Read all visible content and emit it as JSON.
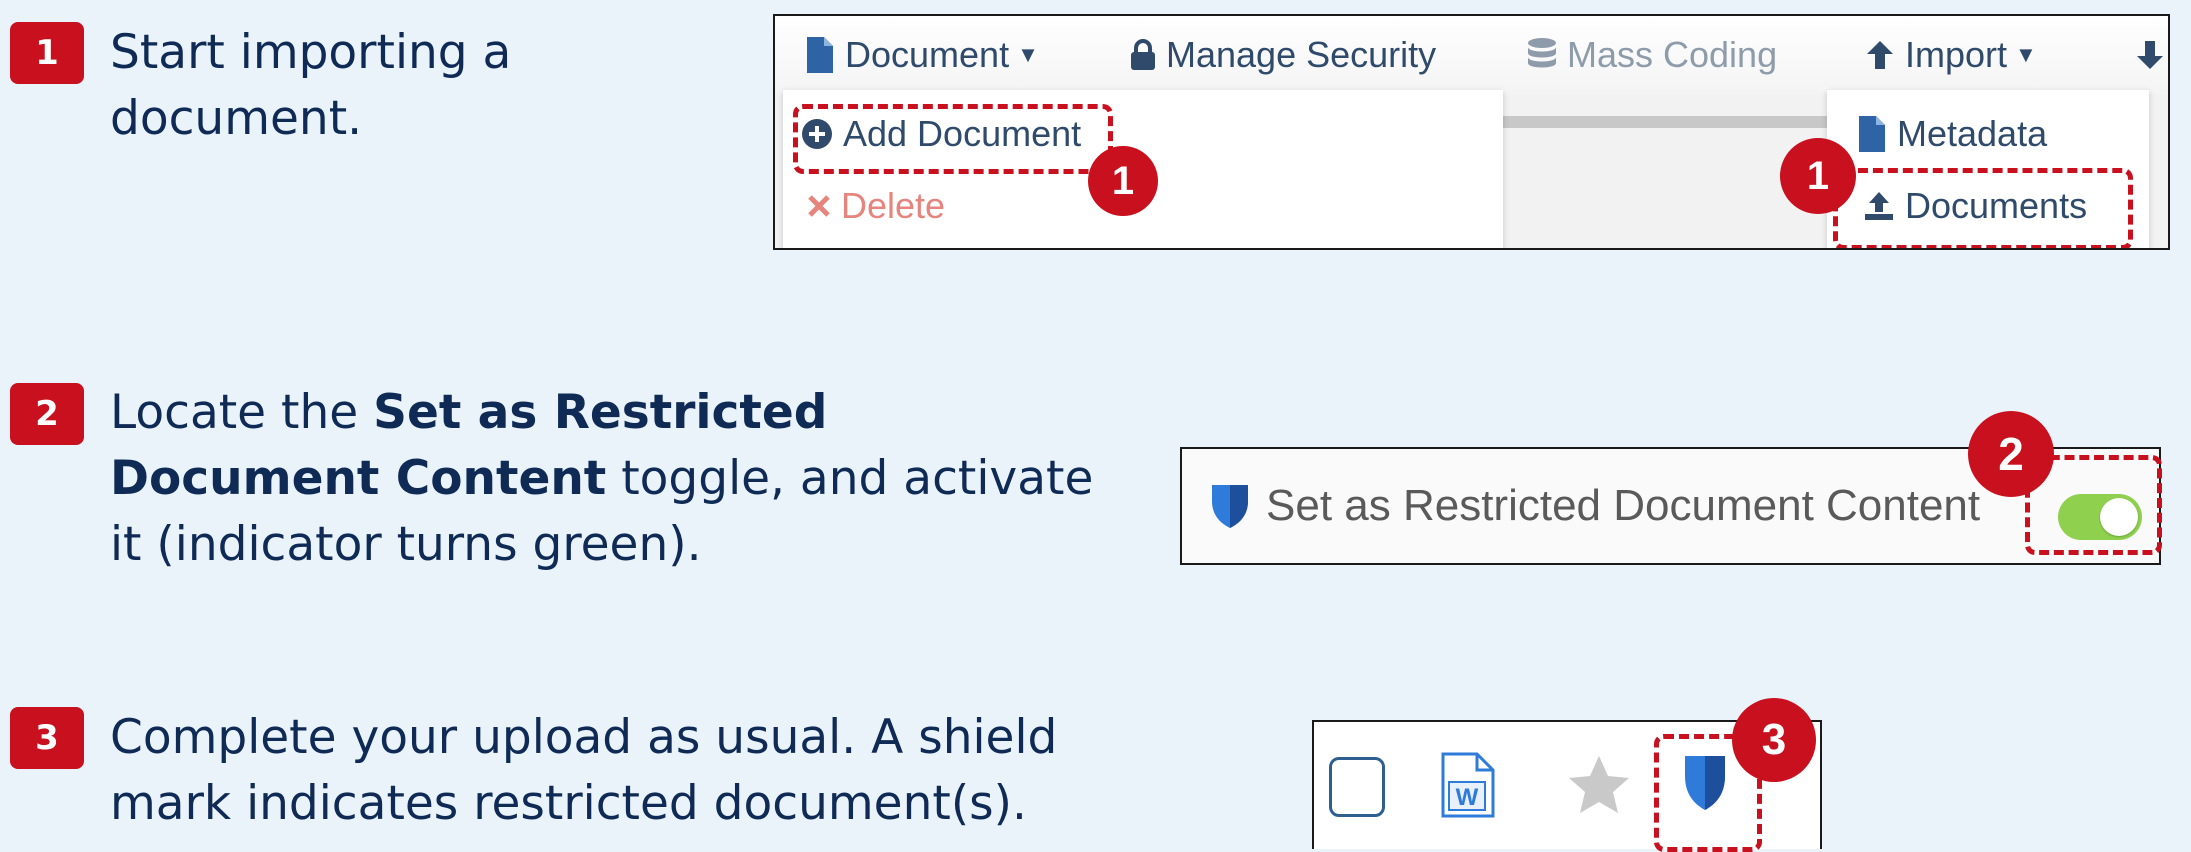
{
  "steps": [
    {
      "number": "1",
      "text": "Start importing a document."
    },
    {
      "number": "2",
      "text_before": "Locate the ",
      "bold": "Set as Restricted Document Content",
      "text_after": " toggle, and activate it (indicator turns green)."
    },
    {
      "number": "3",
      "text": "Complete your upload as usual. A shield mark indicates restricted document(s)."
    }
  ],
  "panel1": {
    "toolbar": {
      "document": "Document",
      "manage_security": "Manage Security",
      "mass_coding": "Mass Coding",
      "import": "Import"
    },
    "document_menu": {
      "add_document": "Add Document",
      "delete": "Delete"
    },
    "import_menu": {
      "metadata": "Metadata",
      "documents": "Documents"
    },
    "marker": "1"
  },
  "panel2": {
    "toggle_label": "Set as Restricted Document Content",
    "toggle_on": true,
    "marker": "2"
  },
  "panel3": {
    "marker": "3"
  },
  "colors": {
    "accent_red": "#c8101e",
    "toggle_on": "#8fd14f",
    "icon_blue": "#2e63a5",
    "text_navy": "#0e2a55"
  },
  "icons": [
    "file-icon",
    "lock-icon",
    "database-icon",
    "arrow-up-icon",
    "arrow-down-icon",
    "plus-circle-icon",
    "x-icon",
    "upload-icon",
    "shield-icon",
    "word-file-icon",
    "star-icon",
    "checkbox-icon"
  ]
}
